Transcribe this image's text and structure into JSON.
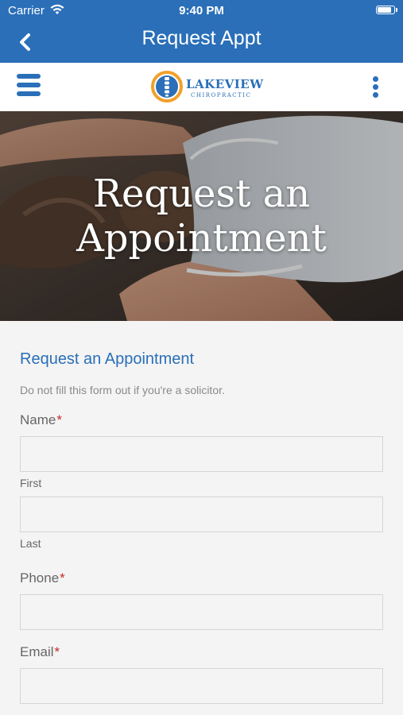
{
  "status_bar": {
    "carrier": "Carrier",
    "time": "9:40 PM",
    "battery_level": 0.9
  },
  "nav_bar": {
    "title": "Request Appt"
  },
  "site_header": {
    "logo": {
      "name": "LAKEVIEW",
      "tagline": "CHIROPRACTIC"
    }
  },
  "hero": {
    "title_line1": "Request an",
    "title_line2": "Appointment"
  },
  "form": {
    "heading": "Request an Appointment",
    "note": "Do not fill this form out if you're a solicitor.",
    "required_mark": "*",
    "name": {
      "label": "Name",
      "first_sublabel": "First",
      "last_sublabel": "Last",
      "first_value": "",
      "last_value": ""
    },
    "phone": {
      "label": "Phone",
      "value": ""
    },
    "email": {
      "label": "Email",
      "value": ""
    }
  },
  "colors": {
    "brand_blue": "#2a6fb8",
    "required_red": "#c62828",
    "logo_orange": "#f2a02b"
  },
  "icons": [
    "wifi-icon",
    "battery-icon",
    "back-chevron-icon",
    "hamburger-menu-icon",
    "spine-logo-icon",
    "kebab-menu-icon"
  ]
}
